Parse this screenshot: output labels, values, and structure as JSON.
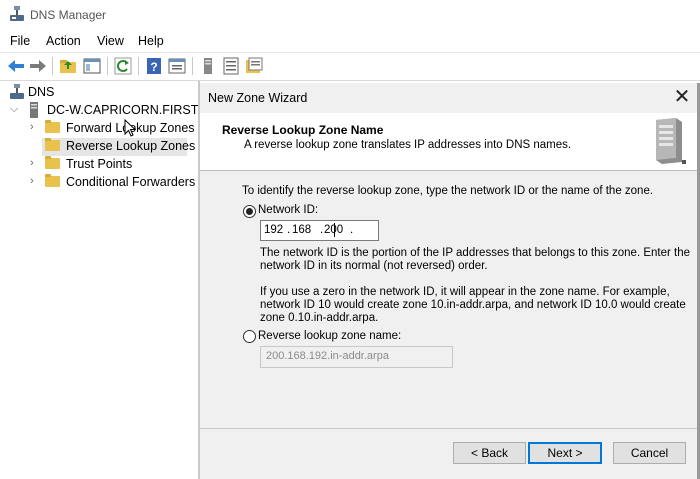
{
  "window": {
    "title": "DNS Manager"
  },
  "menu": {
    "file": "File",
    "action": "Action",
    "view": "View",
    "help": "Help"
  },
  "toolbar": {
    "icons": [
      "back-icon",
      "forward-icon",
      "up-folder-icon",
      "show-hide-console-tree-icon",
      "refresh-icon",
      "help-icon",
      "properties-icon",
      "server-icon",
      "list-icon",
      "folder-list-icon"
    ]
  },
  "tree": {
    "root": "DNS",
    "server": "DC-W.CAPRICORN.FIRST",
    "items": [
      {
        "label": "Forward Lookup Zones"
      },
      {
        "label": "Reverse Lookup Zones",
        "selected": true
      },
      {
        "label": "Trust Points"
      },
      {
        "label": "Conditional Forwarders"
      }
    ]
  },
  "wizard": {
    "title": "New Zone Wizard",
    "close": "✕",
    "header_title": "Reverse Lookup Zone Name",
    "header_subtitle": "A reverse lookup zone translates IP addresses into DNS names.",
    "instruction": "To identify the reverse lookup zone, type the network ID or the name of the zone.",
    "network_id_label": "Network ID:",
    "network_id": {
      "o1": "192",
      "o2": "168",
      "o3": "200",
      "o4": "",
      "sep": "."
    },
    "explain_line1": "The network ID is the portion of the IP addresses that belongs to this zone. Enter the",
    "explain_line2": "network ID in its normal (not reversed) order.",
    "zero_line1": "If you use a zero in the network ID, it will appear in the zone name. For example,",
    "zero_line2": "network ID 10 would create zone 10.in-addr.arpa, and network ID 10.0 would create",
    "zero_line3": "zone 0.10.in-addr.arpa.",
    "rlz_label": "Reverse lookup zone name:",
    "rlz_value": "200.168.192.in-addr.arpa",
    "network_id_selected": true,
    "back": "< Back",
    "next": "Next >",
    "cancel": "Cancel"
  },
  "colors": {
    "selection": "#e5e5e5",
    "folder": "#e9c14d",
    "dialog_bg": "#f0f0f0",
    "focus": "#0078d7"
  }
}
